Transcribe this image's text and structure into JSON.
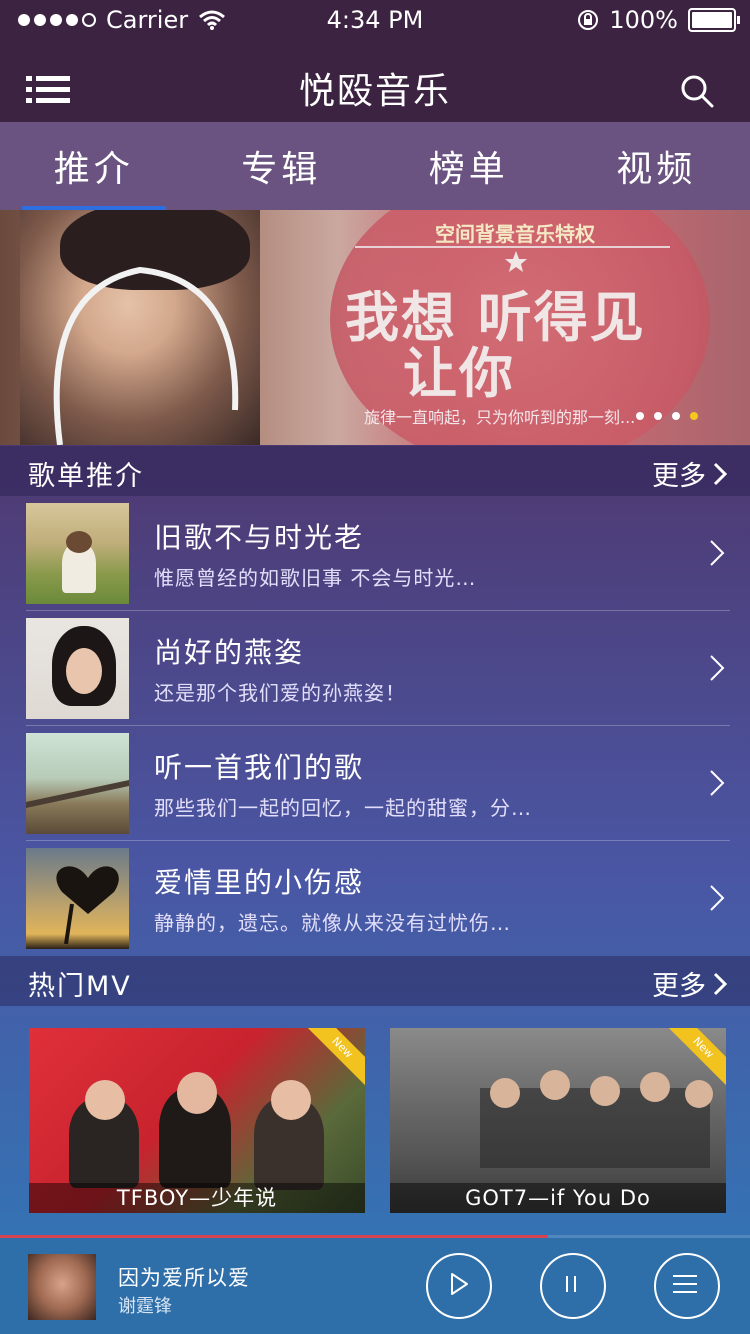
{
  "status_bar": {
    "carrier": "Carrier",
    "time": "4:34 PM",
    "battery": "100%"
  },
  "nav": {
    "title": "悦殴音乐"
  },
  "tabs": [
    {
      "label": "推介"
    },
    {
      "label": "专辑"
    },
    {
      "label": "榜单"
    },
    {
      "label": "视频"
    }
  ],
  "banner": {
    "top_text": "空间背景音乐特权",
    "headline_line1": "我想 听得见",
    "headline_line2": "让你",
    "sub_text": "旋律一直响起，只为你听到的那一刻...",
    "total_slides": 4,
    "active_slide": 4
  },
  "playlists_section": {
    "title": "歌单推介",
    "more": "更多"
  },
  "playlists": [
    {
      "title": "旧歌不与时光老",
      "subtitle": "惟愿曾经的如歌旧事  不会与时光…"
    },
    {
      "title": "尚好的燕姿",
      "subtitle": "还是那个我们爱的孙燕姿！"
    },
    {
      "title": "听一首我们的歌",
      "subtitle": "那些我们一起的回忆，一起的甜蜜，分…"
    },
    {
      "title": "爱情里的小伤感",
      "subtitle": "静静的，遗忘。就像从来没有过忧伤…"
    }
  ],
  "mv_section": {
    "title": "热门MV",
    "more": "更多"
  },
  "mvs": [
    {
      "caption": "TFBOY—少年说",
      "badge": "New"
    },
    {
      "caption": "GOT7—if You Do",
      "badge": "New"
    }
  ],
  "player": {
    "song": "因为爱所以爱",
    "artist": "谢霆锋",
    "progress": 0.73
  }
}
